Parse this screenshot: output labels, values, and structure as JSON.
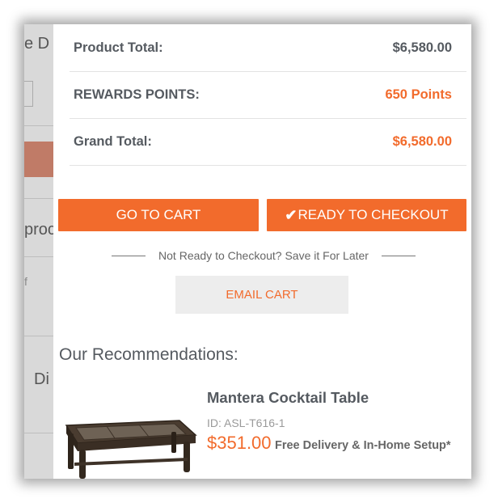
{
  "background": {
    "frag_top": "e D",
    "frag_mid": "proc",
    "frag_f": "f",
    "frag_low": "Di"
  },
  "summary": {
    "product_total_label": "Product Total:",
    "product_total_value": "$6,580.00",
    "rewards_label": "REWARDS POINTS:",
    "rewards_value": "650 Points",
    "grand_total_label": "Grand Total:",
    "grand_total_value": "$6,580.00"
  },
  "actions": {
    "go_to_cart": "GO TO CART",
    "checkmark_icon": "check-icon",
    "ready_to_checkout": "READY TO CHECKOUT",
    "save_prompt": "Not Ready to Checkout? Save it For Later",
    "email_cart": "EMAIL CART"
  },
  "recommendations": {
    "title": "Our Recommendations:",
    "items": [
      {
        "name": "Mantera Cocktail Table",
        "id": "ID: ASL-T616-1",
        "price": "$351.00",
        "delivery": "Free Delivery & In-Home Setup*"
      }
    ]
  },
  "colors": {
    "accent": "#f26b2c",
    "text": "#555a60",
    "button_gray": "#ededed"
  }
}
